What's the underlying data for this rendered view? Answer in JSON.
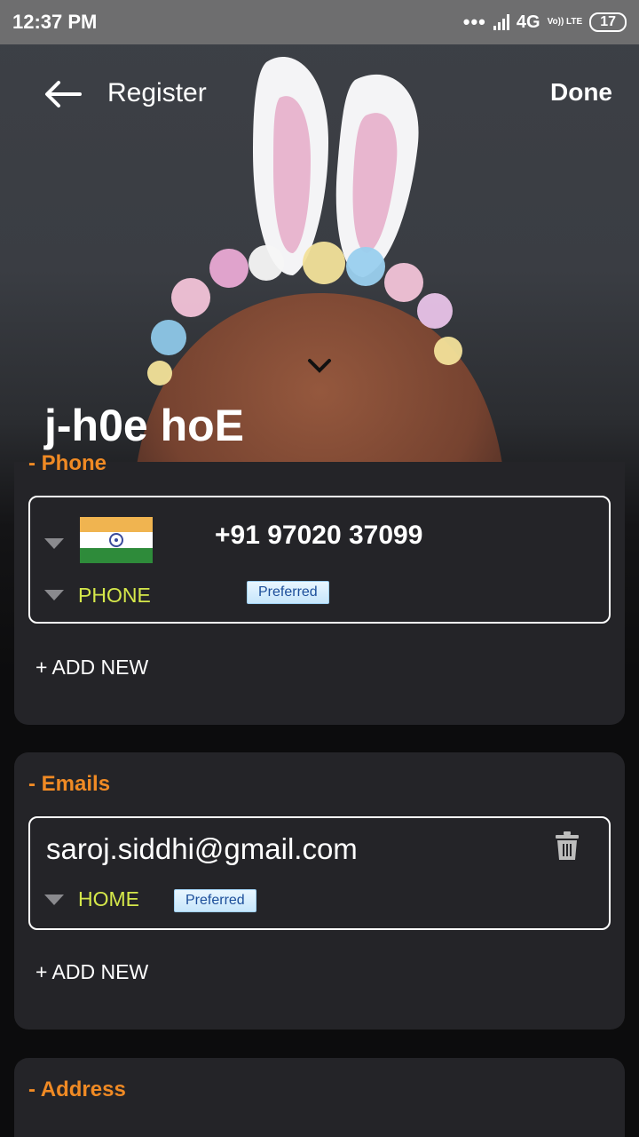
{
  "status_bar": {
    "time": "12:37 PM",
    "network": "4G",
    "volte": "Vo)) LTE",
    "battery": "17"
  },
  "app_bar": {
    "back_icon": "arrow-left-icon",
    "title": "Register",
    "done_label": "Done"
  },
  "profile": {
    "name": "j-h0e hoE",
    "expand_icon": "chevron-down-icon"
  },
  "phone_section": {
    "title": "- Phone",
    "entry": {
      "country_flag": "india-flag",
      "number": "+91  97020 37099",
      "type": "PHONE",
      "badge": "Preferred"
    },
    "add_new": "+ ADD NEW"
  },
  "emails_section": {
    "title": "- Emails",
    "entry": {
      "email": "saroj.siddhi@gmail.com",
      "type": "HOME",
      "badge": "Preferred",
      "delete_icon": "trash-icon"
    },
    "add_new": "+ ADD NEW"
  },
  "address_section": {
    "title": "- Address"
  },
  "colors": {
    "accent_orange": "#f08a24",
    "type_label_yellow": "#d5e84a",
    "card_bg": "#242428"
  }
}
